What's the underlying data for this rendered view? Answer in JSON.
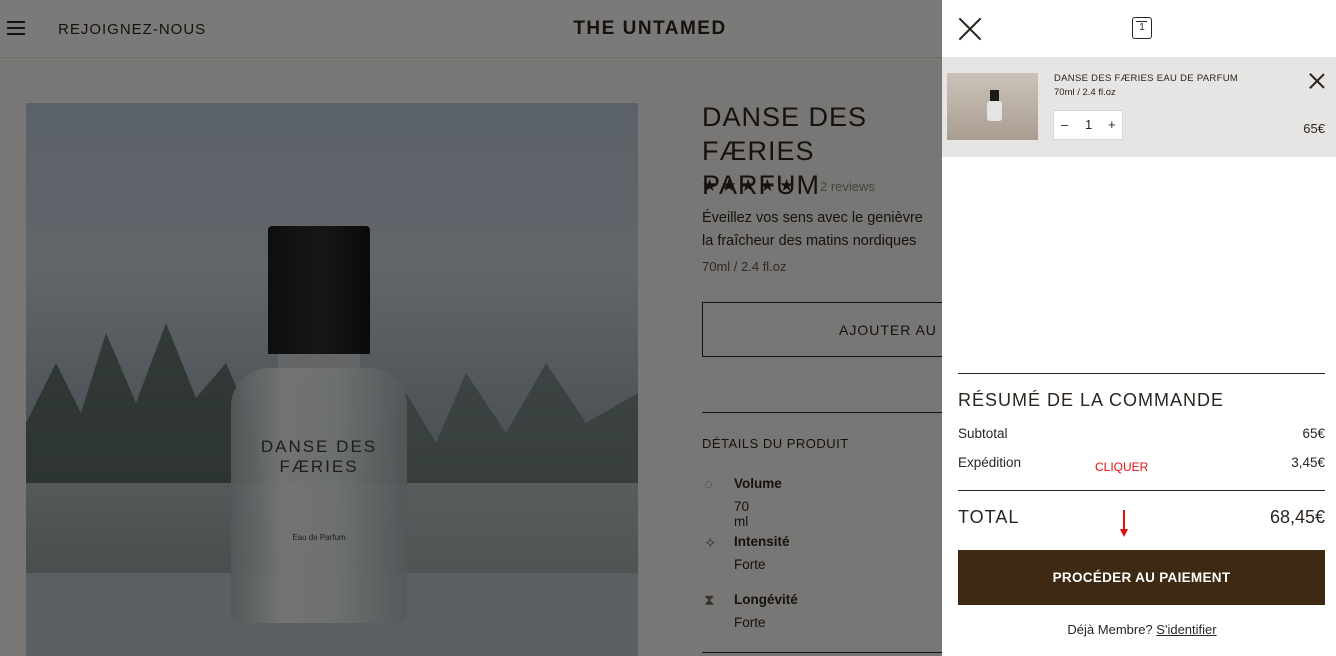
{
  "header": {
    "join_label": "REJOIGNEZ-NOUS",
    "brand": "THE UNTAMED",
    "menu_icon": "hamburger-menu-icon"
  },
  "product": {
    "image_label": "DANSE DES FÆRIES",
    "image_sublabel": "Eau de Parfum",
    "title_line1": "DANSE DES FÆRIES",
    "title_line2": "PARFUM",
    "stars": "★★★★★",
    "reviews": "2 reviews",
    "desc_line1": "Éveillez vos sens avec le genièvre",
    "desc_line2": "la fraîcheur des matins nordiques",
    "size": "70ml / 2.4 fl.oz",
    "add_button": "AJOUTER AU P",
    "details_heading": "DÉTAILS DU PRODUIT",
    "specs": [
      {
        "label": "Volume",
        "value": "70 ml",
        "icon": "drop-icon"
      },
      {
        "label": "Intensité",
        "value": "Forte",
        "icon": "sparkle-icon"
      },
      {
        "label": "Longévité",
        "value": "Forte",
        "icon": "hourglass-icon"
      }
    ]
  },
  "cart": {
    "close_icon": "close-icon",
    "bag_icon": "bag-icon",
    "bag_count": "1",
    "item": {
      "name": "DANSE DES FÆRIES EAU DE PARFUM",
      "size": "70ml / 2.4 fl.oz",
      "qty_minus": "–",
      "qty": "1",
      "qty_plus": "+",
      "price": "65€"
    },
    "summary": {
      "title": "RÉSUMÉ DE LA COMMANDE",
      "subtotal_label": "Subtotal",
      "subtotal_value": "65€",
      "shipping_label": "Expédition",
      "shipping_value": "3,45€",
      "total_label": "TOTAL",
      "total_value": "68,45€"
    },
    "annotation": "CLIQUER",
    "annotation_color": "#e10f0f",
    "checkout_button": "PROCÉDER AU PAIEMENT",
    "member_prefix": "Déjà Membre?",
    "member_link": "S'identifier"
  },
  "colors": {
    "checkout_bg": "#3e2a12",
    "overlay": "rgba(0,0,0,0.5)"
  }
}
